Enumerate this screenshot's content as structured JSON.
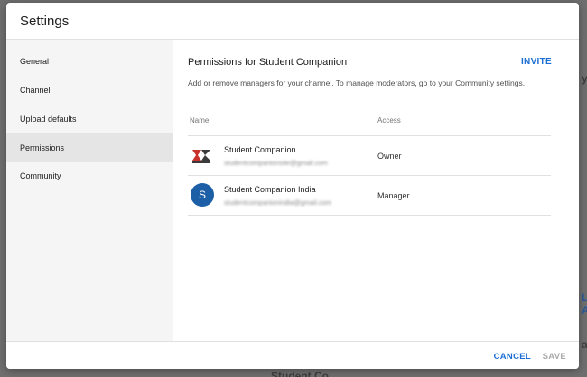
{
  "backdrop": {
    "frag_a": "yt",
    "frag_b": "L A",
    "frag_c": "ab",
    "frag_d": "Student Co"
  },
  "dialog": {
    "title": "Settings"
  },
  "sidebar": {
    "items": [
      {
        "label": "General",
        "active": false
      },
      {
        "label": "Channel",
        "active": false
      },
      {
        "label": "Upload defaults",
        "active": false
      },
      {
        "label": "Permissions",
        "active": true
      },
      {
        "label": "Community",
        "active": false
      }
    ]
  },
  "main": {
    "title": "Permissions for Student Companion",
    "invite_label": "INVITE",
    "description": "Add or remove managers for your channel. To manage moderators, go to your Community settings.",
    "table": {
      "headers": {
        "name": "Name",
        "access": "Access"
      },
      "rows": [
        {
          "name": "Student Companion",
          "email": "studentcompanionsite@gmail.com",
          "access": "Owner",
          "avatar": "logo"
        },
        {
          "name": "Student Companion India",
          "email": "studentcompanionindia@gmail.com",
          "access": "Manager",
          "avatar": "S"
        }
      ]
    }
  },
  "footer": {
    "cancel_label": "CANCEL",
    "save_label": "SAVE"
  },
  "colors": {
    "accent": "#1b6ed4",
    "avatar_blue": "#1d5fa6",
    "active_nav": "#e5e5e5"
  }
}
